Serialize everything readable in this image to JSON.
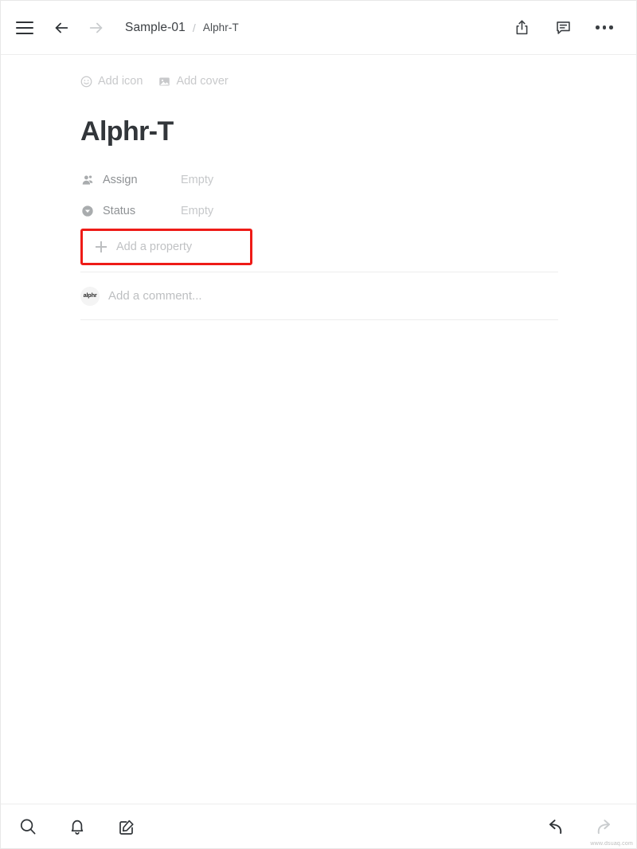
{
  "topbar": {
    "menu_icon": "hamburger-menu-icon",
    "back_icon": "arrow-left-icon",
    "forward_icon": "arrow-right-icon",
    "breadcrumb": {
      "parent": "Sample-01",
      "separator": "/",
      "current": "Alphr-T"
    },
    "share_icon": "share-icon",
    "comments_icon": "comment-bubble-icon",
    "more_icon": "more-options-icon"
  },
  "page": {
    "add_icon_label": "Add icon",
    "add_cover_label": "Add cover",
    "title": "Alphr-T",
    "properties": [
      {
        "icon": "person-icon",
        "label": "Assign",
        "value": "Empty"
      },
      {
        "icon": "status-select-icon",
        "label": "Status",
        "value": "Empty"
      }
    ],
    "add_property_label": "Add a property",
    "highlight_color": "#ee1b17",
    "comment": {
      "avatar_text": "alphr",
      "placeholder": "Add a comment..."
    }
  },
  "bottombar": {
    "search_icon": "search-icon",
    "notifications_icon": "bell-icon",
    "new_page_icon": "new-page-edit-icon",
    "undo_icon": "undo-arrow-icon",
    "redo_icon": "redo-arrow-icon",
    "watermark": "www.dsuaq.com"
  }
}
